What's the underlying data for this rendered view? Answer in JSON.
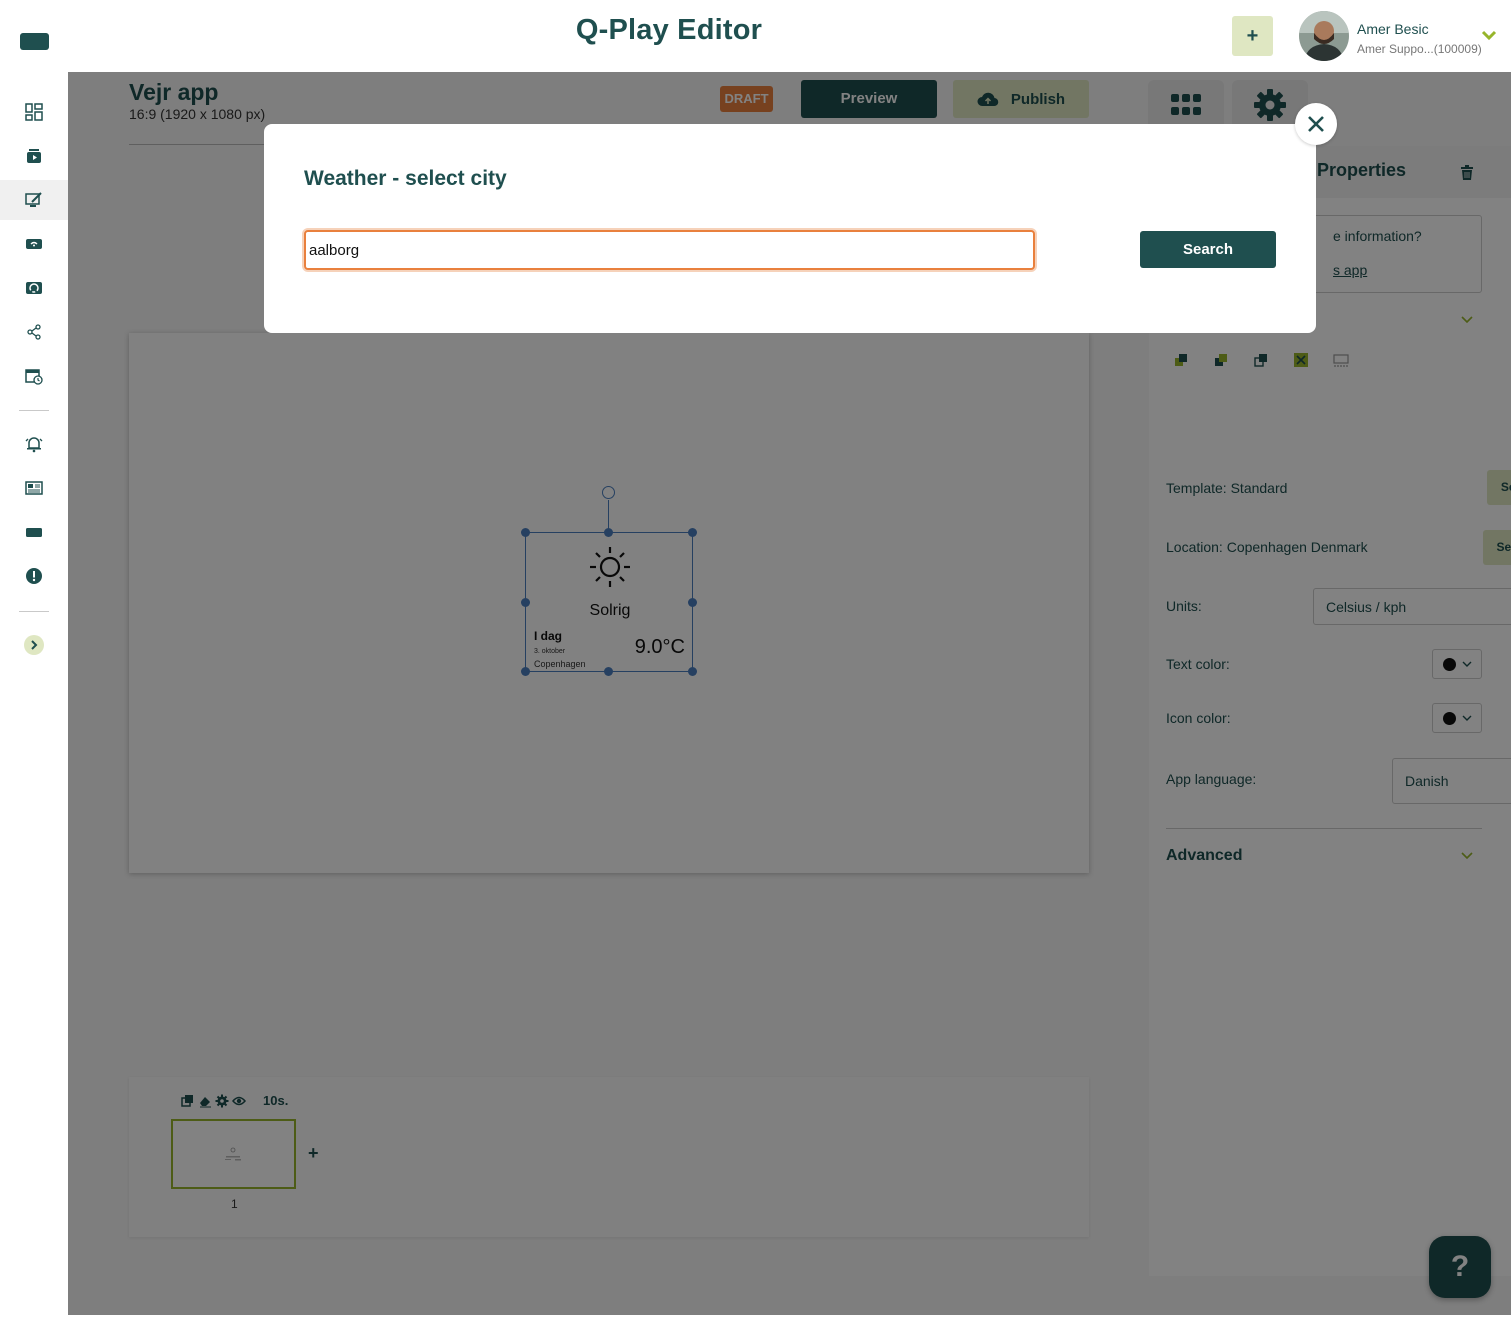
{
  "header": {
    "app_title": "Q-Play Editor",
    "add_label": "+",
    "user_name": "Amer Besic",
    "user_org": "Amer Suppo...(100009)"
  },
  "sidebar": {
    "items": [
      {
        "icon": "dashboard-icon"
      },
      {
        "icon": "media-library-icon"
      },
      {
        "icon": "editor-icon",
        "active": true
      },
      {
        "icon": "screens-icon"
      },
      {
        "icon": "playlists-icon"
      },
      {
        "icon": "share-icon"
      },
      {
        "icon": "schedule-icon"
      },
      {
        "icon": "alerts-icon"
      },
      {
        "icon": "news-icon"
      },
      {
        "icon": "devices-icon"
      },
      {
        "icon": "warning-icon"
      },
      {
        "icon": "expand-sidebar-icon"
      }
    ]
  },
  "document": {
    "title": "Vejr app",
    "resolution": "16:9 (1920 x 1080 px)",
    "status_badge": "DRAFT",
    "preview_label": "Preview",
    "publish_label": "Publish"
  },
  "weather_widget": {
    "condition": "Solrig",
    "day": "I dag",
    "date": "3. oktober",
    "city": "Copenhagen",
    "temperature": "9.0°C"
  },
  "timeline": {
    "duration": "10s.",
    "add_label": "+",
    "slides": [
      {
        "number": "1"
      }
    ]
  },
  "properties": {
    "title": "Properties",
    "info_question": "e information?",
    "info_link": "s app",
    "template_label": "Template: Standard",
    "template_button": "Select",
    "location_label": "Location: Copenhagen Denmark",
    "location_button": "Search",
    "units_label": "Units:",
    "units_value": "Celsius / kph",
    "text_color_label": "Text color:",
    "text_color_value": "#111111",
    "icon_color_label": "Icon color:",
    "icon_color_value": "#111111",
    "language_label": "App language:",
    "language_value": "Danish",
    "advanced_label": "Advanced"
  },
  "modal": {
    "title": "Weather - select city",
    "input_value": "aalborg",
    "search_label": "Search"
  },
  "help": {
    "label": "?"
  },
  "colors": {
    "brand_dark": "#1f4f4f",
    "brand_light": "#dfe7c2",
    "accent_orange": "#e9803d",
    "accent_green": "#97b52b"
  }
}
